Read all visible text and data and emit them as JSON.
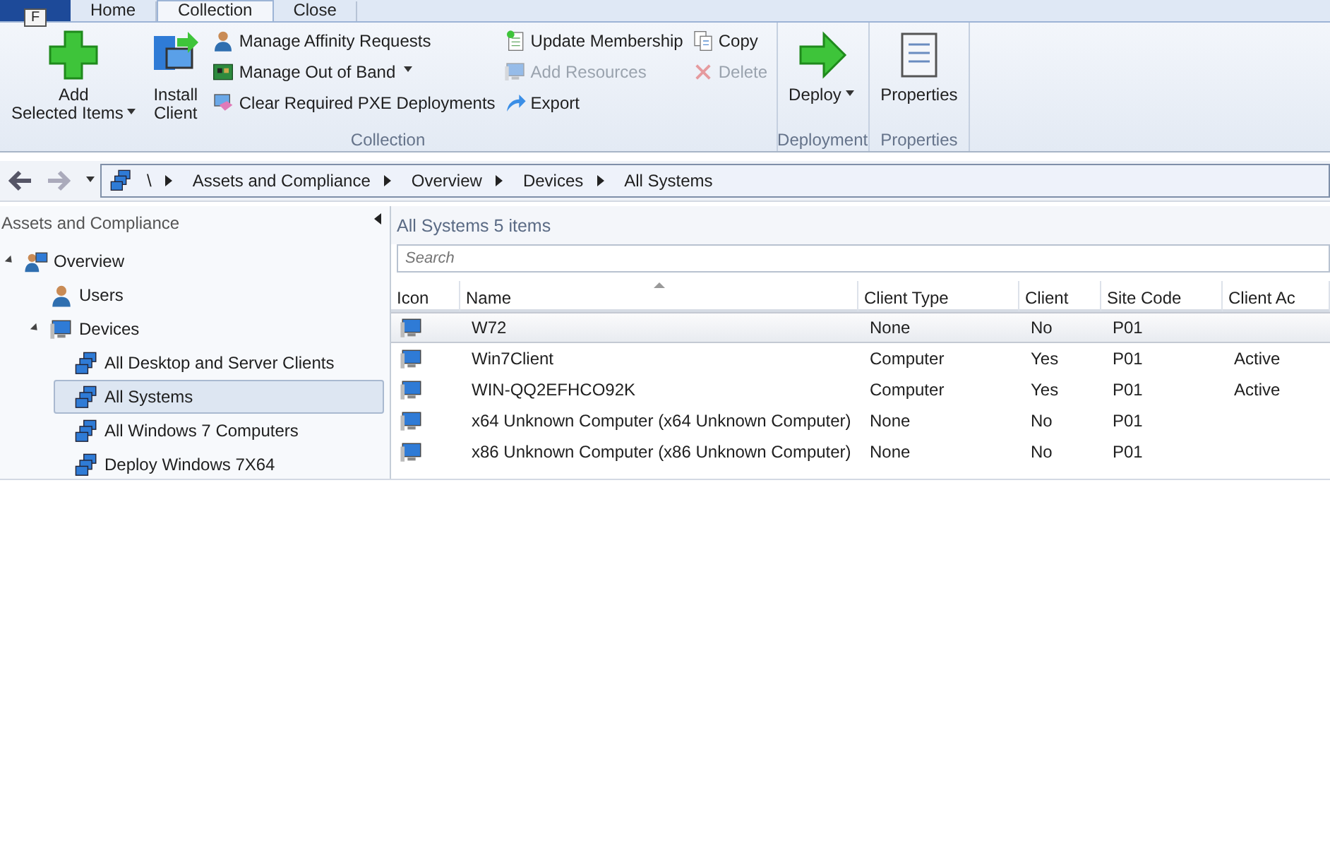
{
  "file_button": {
    "label": "F"
  },
  "tabs": [
    {
      "label": "Home",
      "selected": false
    },
    {
      "label": "Collection",
      "selected": true
    },
    {
      "label": "Close",
      "selected": false
    }
  ],
  "ribbon_groups": [
    {
      "label": "Collection",
      "large_buttons": [
        {
          "label": "Add\nSelected Items",
          "kind": "plus",
          "dropdown": true
        },
        {
          "label": "Install\nClient",
          "kind": "install",
          "dropdown": false
        }
      ],
      "small_columns": [
        [
          {
            "label": "Manage Affinity Requests",
            "kind": "user",
            "disabled": false,
            "dropdown": false
          },
          {
            "label": "Manage Out of Band",
            "kind": "board",
            "disabled": false,
            "dropdown": true
          },
          {
            "label": "Clear Required PXE Deployments",
            "kind": "eraser",
            "disabled": false,
            "dropdown": false
          }
        ],
        [
          {
            "label": "Update Membership",
            "kind": "doc",
            "disabled": false,
            "dropdown": false
          },
          {
            "label": "Add Resources",
            "kind": "computer",
            "disabled": true,
            "dropdown": false
          },
          {
            "label": "Export",
            "kind": "export",
            "disabled": false,
            "dropdown": false
          }
        ],
        [
          {
            "label": "Copy",
            "kind": "copy",
            "disabled": false,
            "dropdown": false
          },
          {
            "label": "Delete",
            "kind": "delete",
            "disabled": true,
            "dropdown": false
          }
        ]
      ]
    },
    {
      "label": "Deployment",
      "large_buttons": [
        {
          "label": "Deploy",
          "kind": "arrow",
          "dropdown": true
        }
      ]
    },
    {
      "label": "Properties",
      "large_buttons": [
        {
          "label": "Properties",
          "kind": "sheet",
          "dropdown": false
        }
      ]
    }
  ],
  "breadcrumb": [
    "\\",
    "Assets and Compliance",
    "Overview",
    "Devices",
    "All Systems"
  ],
  "sidebar": {
    "title": "Assets and Compliance",
    "items": [
      {
        "label": "Overview",
        "kind": "overview",
        "expanded": true,
        "selected": false,
        "children": [
          {
            "label": "Users",
            "kind": "user",
            "selected": false
          },
          {
            "label": "Devices",
            "kind": "computer",
            "expanded": true,
            "selected": false,
            "children": [
              {
                "label": "All Desktop and Server Clients",
                "kind": "collection",
                "selected": false
              },
              {
                "label": "All Systems",
                "kind": "collection",
                "selected": true
              },
              {
                "label": "All Windows 7 Computers",
                "kind": "collection",
                "selected": false
              },
              {
                "label": "Deploy Windows 7X64",
                "kind": "collection",
                "selected": false
              }
            ]
          }
        ]
      }
    ]
  },
  "list": {
    "title": "All Systems",
    "count": "5 items",
    "search": {
      "placeholder": "Search"
    },
    "columns": [
      {
        "label": "Icon",
        "sorted": false
      },
      {
        "label": "Name",
        "sorted": true
      },
      {
        "label": "Client Type",
        "sorted": false
      },
      {
        "label": "Client",
        "sorted": false
      },
      {
        "label": "Site Code",
        "sorted": false
      },
      {
        "label": "Client Ac",
        "sorted": false
      }
    ],
    "rows": [
      {
        "selected": true,
        "cells": [
          "",
          "W72",
          "None",
          "No",
          "P01",
          ""
        ]
      },
      {
        "selected": false,
        "cells": [
          "",
          "Win7Client",
          "Computer",
          "Yes",
          "P01",
          "Active"
        ]
      },
      {
        "selected": false,
        "cells": [
          "",
          "WIN-QQ2EFHCO92K",
          "Computer",
          "Yes",
          "P01",
          "Active"
        ]
      },
      {
        "selected": false,
        "cells": [
          "",
          "x64 Unknown Computer (x64 Unknown Computer)",
          "None",
          "No",
          "P01",
          ""
        ]
      },
      {
        "selected": false,
        "cells": [
          "",
          "x86 Unknown Computer (x86 Unknown Computer)",
          "None",
          "No",
          "P01",
          ""
        ]
      }
    ]
  }
}
